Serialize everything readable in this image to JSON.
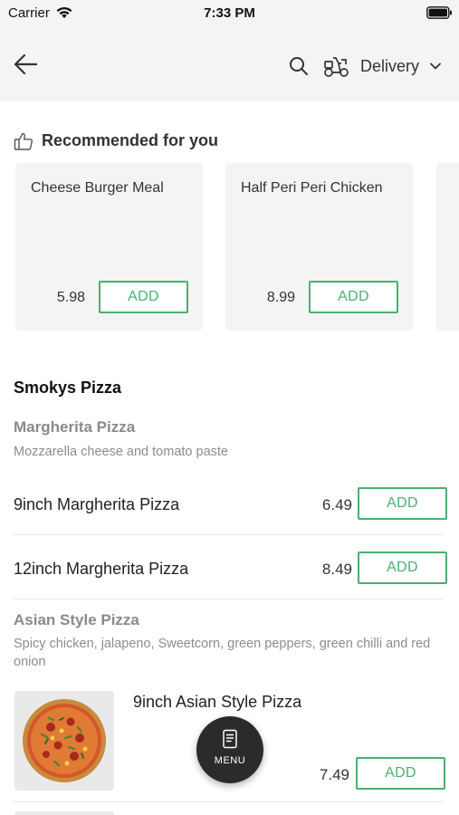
{
  "status_bar": {
    "carrier": "Carrier",
    "time": "7:33 PM"
  },
  "header": {
    "delivery_label": "Delivery"
  },
  "recommended": {
    "title": "Recommended for you",
    "items": [
      {
        "name": "Cheese Burger Meal",
        "price": "5.98",
        "add_label": "ADD"
      },
      {
        "name": "Half Peri Peri Chicken",
        "price": "8.99",
        "add_label": "ADD"
      }
    ]
  },
  "category": {
    "title": "Smokys Pizza",
    "groups": [
      {
        "title": "Margherita Pizza",
        "description": "Mozzarella cheese and tomato paste",
        "items": [
          {
            "name": "9inch Margherita Pizza",
            "price": "6.49",
            "add_label": "ADD"
          },
          {
            "name": "12inch Margherita Pizza",
            "price": "8.49",
            "add_label": "ADD"
          }
        ]
      },
      {
        "title": "Asian Style Pizza",
        "description": "Spicy chicken, jalapeno, Sweetcorn, green peppers, green chilli and red onion",
        "items": [
          {
            "name": "9inch Asian Style Pizza",
            "price": "7.49",
            "add_label": "ADD"
          }
        ]
      }
    ]
  },
  "fab": {
    "label": "MENU"
  },
  "colors": {
    "accent": "#4caf70",
    "header_bg": "#f4f4f4",
    "fab_bg": "#2b2b2b"
  }
}
